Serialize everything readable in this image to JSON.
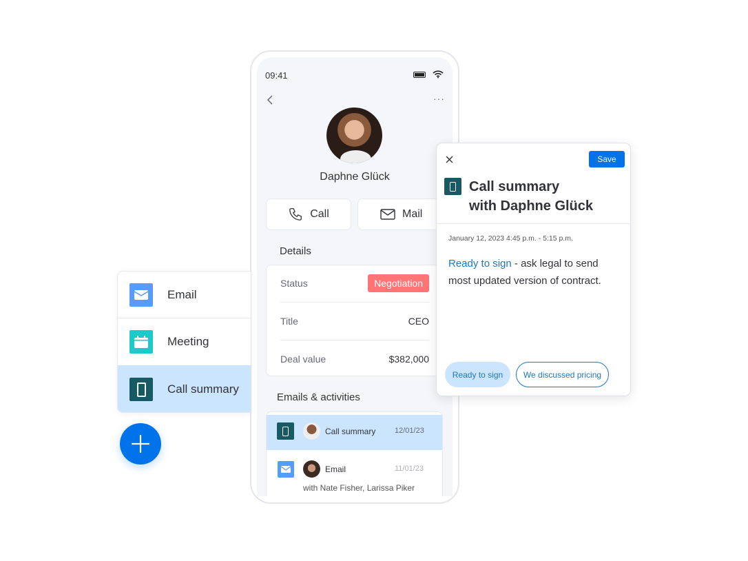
{
  "phone": {
    "status_time": "09:41",
    "contact_name": "Daphne Glück",
    "actions": {
      "call": "Call",
      "mail": "Mail"
    },
    "details": {
      "heading": "Details",
      "rows": [
        {
          "label": "Status",
          "value": "Negotiation"
        },
        {
          "label": "Title",
          "value": "CEO"
        },
        {
          "label": "Deal value",
          "value": "$382,000"
        }
      ],
      "status_color": "#ff7575"
    },
    "activities": {
      "heading": "Emails & activities",
      "items": [
        {
          "type": "Call summary",
          "date": "12/01/23",
          "icon": "phone-icon"
        },
        {
          "type": "Email",
          "date": "11/01/23",
          "icon": "mail-icon",
          "subtitle": "with Nate Fisher, Larissa Piker"
        }
      ]
    }
  },
  "menu": {
    "items": [
      {
        "label": "Email",
        "icon": "mail-icon",
        "color": "#579bfc"
      },
      {
        "label": "Meeting",
        "icon": "calendar-icon",
        "color": "#1dc9c9"
      },
      {
        "label": "Call summary",
        "icon": "phone-icon",
        "color": "#175a63",
        "selected": true
      }
    ]
  },
  "popup": {
    "save": "Save",
    "title_line1": "Call summary",
    "title_line2": "with Daphne Glück",
    "datetime": "January 12, 2023  4:45 p.m. - 5:15 p.m.",
    "body_highlight": "Ready to sign",
    "body_rest": " - ask legal to send most updated version of contract.",
    "chips": [
      "Ready to sign",
      "We discussed pricing"
    ]
  },
  "colors": {
    "primary": "#0073ea",
    "selected": "#cce5ff",
    "link": "#1f76c2"
  }
}
